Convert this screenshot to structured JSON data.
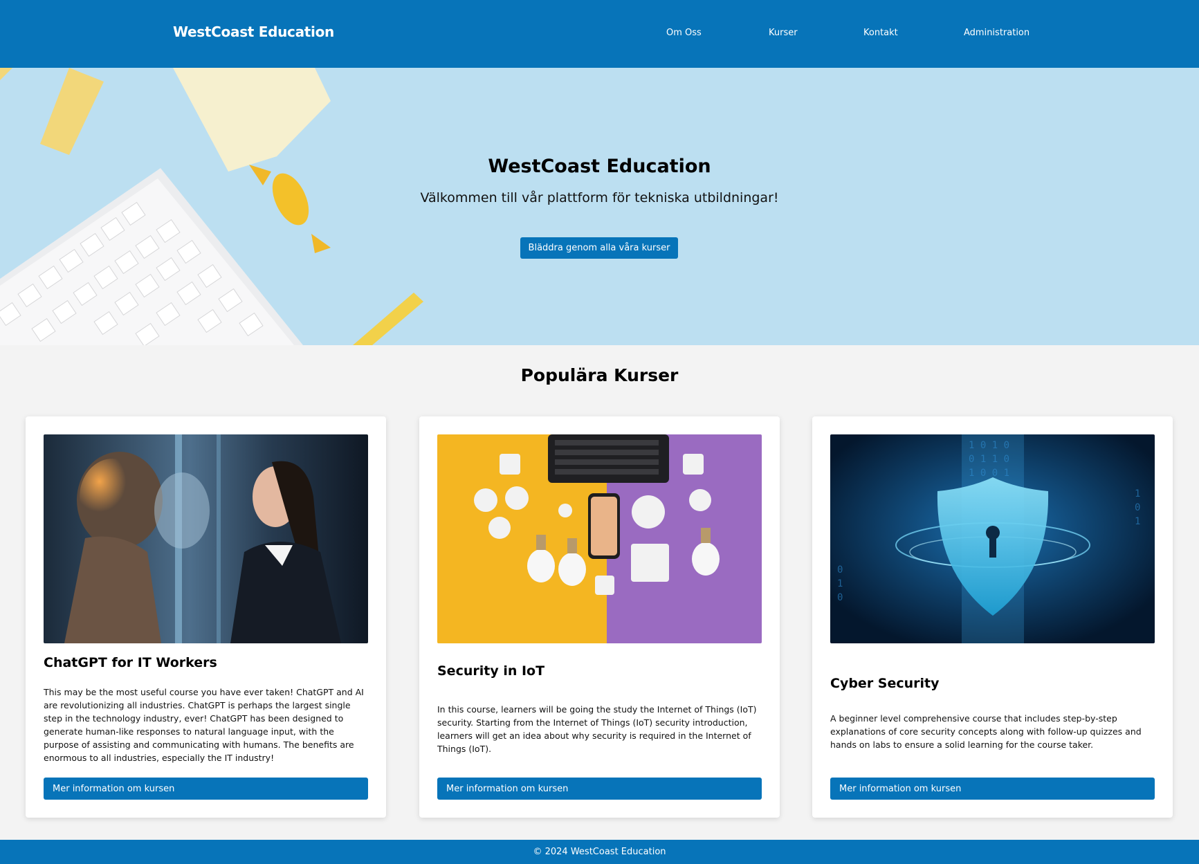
{
  "header": {
    "brand": "WestCoast Education",
    "nav": [
      "Om Oss",
      "Kurser",
      "Kontakt",
      "Administration"
    ]
  },
  "hero": {
    "title": "WestCoast Education",
    "subtitle": "Välkommen till vår plattform för tekniska utbildningar!",
    "button": "Bläddra genom alla våra kurser"
  },
  "popular": {
    "title": "Populära Kurser",
    "courses": [
      {
        "title": "ChatGPT for IT Workers",
        "description": "This may be the most useful course you have ever taken! ChatGPT and AI are revolutionizing all industries. ChatGPT is perhaps the largest single step in the technology industry, ever! ChatGPT has been designed to generate human-like responses to natural language input, with the purpose of assisting and communicating with humans. The benefits are enormous to all industries, especially the IT industry!",
        "button": "Mer information om kursen",
        "image": "ai-robot-and-woman-image"
      },
      {
        "title": "Security in IoT",
        "description": "In this course, learners will be going the study the Internet of Things (IoT) security. Starting from the Internet of Things (IoT) security introduction, learners will get an idea about why security is required in the Internet of Things (IoT).",
        "button": "Mer information om kursen",
        "image": "iot-devices-image"
      },
      {
        "title": "Cyber Security",
        "description": "A beginner level comprehensive course that includes step-by-step explanations of core security concepts along with follow-up quizzes and hands on labs to ensure a solid learning for the course taker.",
        "button": "Mer information om kursen",
        "image": "security-shield-image"
      }
    ]
  },
  "footer": {
    "text": "© 2024 WestCoast Education"
  },
  "colors": {
    "primary": "#0774b9",
    "hero_bg": "#bcdff1",
    "page_bg": "#f3f3f3"
  }
}
